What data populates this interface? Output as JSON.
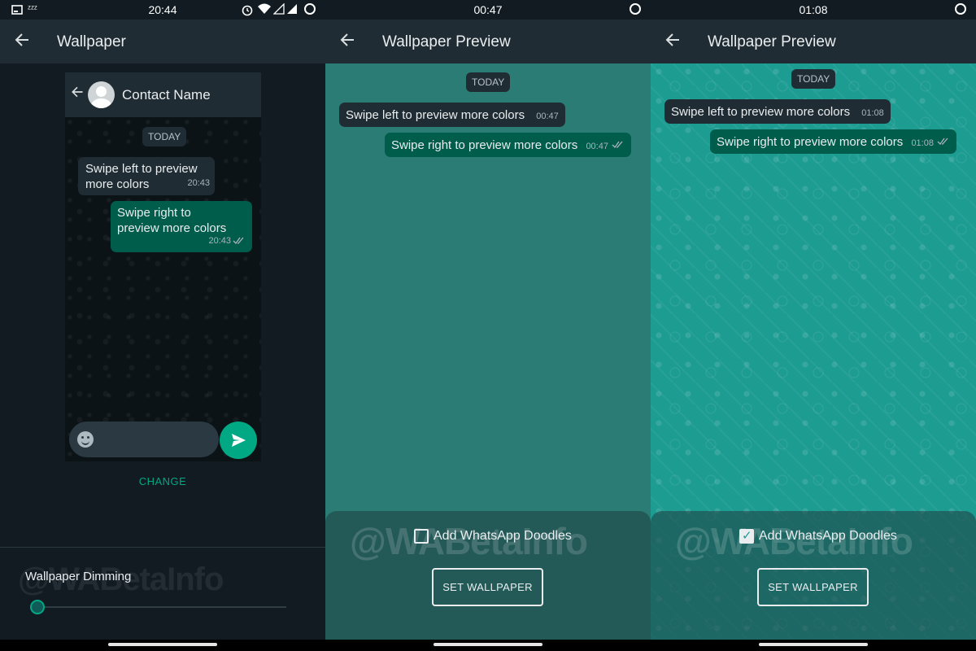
{
  "screens": [
    {
      "status": {
        "time": "20:44",
        "left_icons": [
          "screenshot-icon",
          "sleep-zzz-icon"
        ],
        "right_icons": [
          "alarm-icon",
          "wifi-icon",
          "signal-icon",
          "signal-icon",
          "circle-icon"
        ]
      },
      "appbar": {
        "title": "Wallpaper",
        "back_icon": "arrow-left-icon"
      },
      "preview": {
        "contact_name": "Contact Name",
        "day_chip": "TODAY",
        "incoming": {
          "line1": "Swipe left to preview",
          "line2": "more colors",
          "time": "20:43"
        },
        "outgoing": {
          "line1": "Swipe right to",
          "line2": "preview more colors",
          "time": "20:43",
          "status_icon": "double-check-icon"
        },
        "emoji_icon": "smiley-icon",
        "send_icon": "send-icon"
      },
      "change_label": "CHANGE",
      "dimming": {
        "label": "Wallpaper Dimming",
        "value": 0.0,
        "thumb_icon": "moon-icon"
      },
      "watermark": "@WABetaInfo"
    },
    {
      "status": {
        "time": "00:47",
        "right_icons": [
          "circle-icon"
        ]
      },
      "appbar": {
        "title": "Wallpaper Preview",
        "back_icon": "arrow-left-icon"
      },
      "day_chip": "TODAY",
      "incoming": {
        "text": "Swipe left to preview more colors",
        "time": "00:47"
      },
      "outgoing": {
        "text": "Swipe right to preview more colors",
        "time": "00:47",
        "status_icon": "double-check-icon"
      },
      "sheet": {
        "doodles_label": "Add WhatsApp Doodles",
        "doodles_checked": false,
        "button": "SET WALLPAPER",
        "watermark": "@WABetaInfo"
      },
      "background_color": "#2a7c75"
    },
    {
      "status": {
        "time": "01:08",
        "right_icons": [
          "circle-icon"
        ]
      },
      "appbar": {
        "title": "Wallpaper Preview",
        "back_icon": "arrow-left-icon"
      },
      "day_chip": "TODAY",
      "incoming": {
        "text": "Swipe left to preview more colors",
        "time": "01:08"
      },
      "outgoing": {
        "text": "Swipe right to preview more colors",
        "time": "01:08",
        "status_icon": "double-check-icon"
      },
      "sheet": {
        "doodles_label": "Add WhatsApp Doodles",
        "doodles_checked": true,
        "button": "SET WALLPAPER",
        "watermark": "@WABetaInfo"
      },
      "background_color": "#1d9c92"
    }
  ],
  "colors": {
    "accent": "#00a884",
    "outgoing_bubble": "#005c4b",
    "incoming_bubble": "#202c33",
    "appbar": "#202c33"
  }
}
